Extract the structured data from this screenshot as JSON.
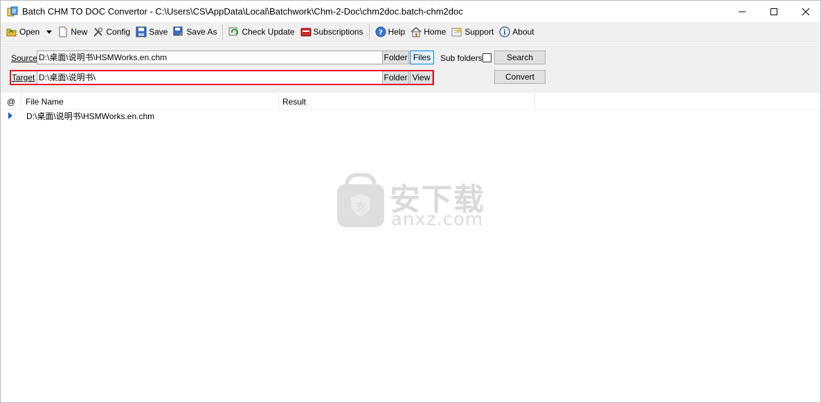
{
  "window": {
    "title": "Batch CHM TO DOC Convertor - C:\\Users\\CS\\AppData\\Local\\Batchwork\\Chm-2-Doc\\chm2doc.batch-chm2doc"
  },
  "toolbar": {
    "open": "Open",
    "new": "New",
    "config": "Config",
    "save": "Save",
    "save_as": "Save As",
    "check_update": "Check Update",
    "subscriptions": "Subscriptions",
    "help": "Help",
    "home": "Home",
    "support": "Support",
    "about": "About"
  },
  "source": {
    "label": "Source",
    "value": "D:\\桌面\\说明书\\HSMWorks.en.chm",
    "folder_btn": "Folder",
    "files_btn": "Files",
    "subfolders_label": "Sub folders",
    "subfolders_checked": false,
    "search_btn": "Search"
  },
  "target": {
    "label": "Target",
    "value": "D:\\桌面\\说明书\\",
    "folder_btn": "Folder",
    "view_btn": "View",
    "convert_btn": "Convert"
  },
  "list": {
    "columns": [
      "@",
      "File Name",
      "Result"
    ],
    "rows": [
      {
        "file_name": "D:\\桌面\\说明书\\HSMWorks.en.chm",
        "result": ""
      }
    ]
  },
  "watermark": {
    "cn": "安下载",
    "en": "anxz.com",
    "badge": "安"
  },
  "colors": {
    "highlight": "#e81123",
    "toolbar_bg": "#f0f0f0",
    "focus_border": "#0078d7",
    "row_arrow": "#1c5ec7"
  }
}
